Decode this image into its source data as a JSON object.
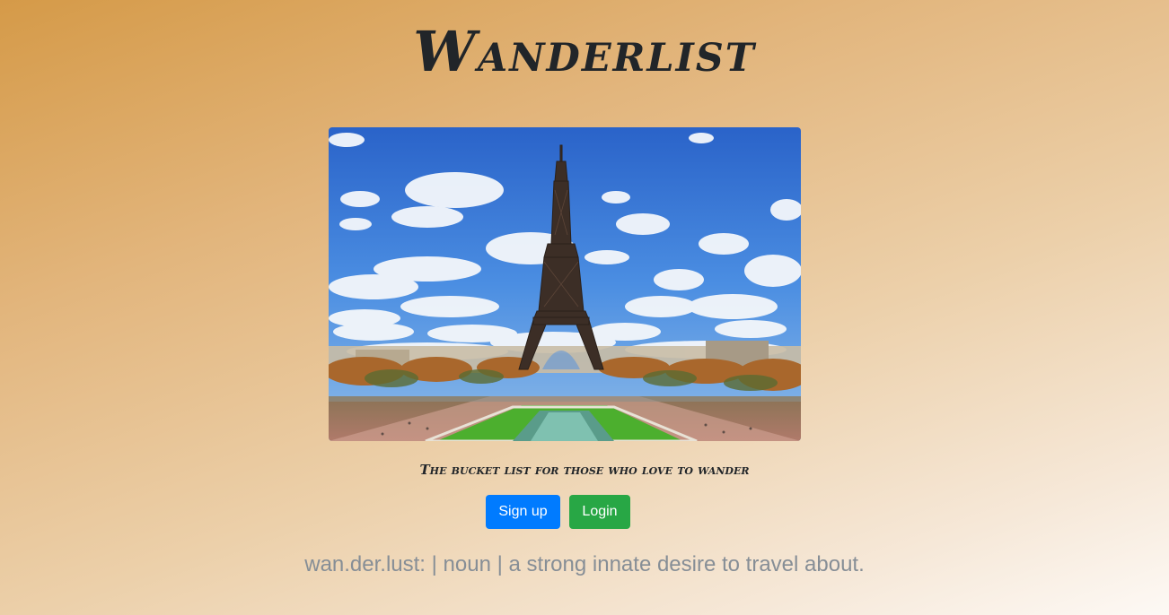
{
  "header": {
    "title": "Wanderlist"
  },
  "hero": {
    "alt": "Eiffel Tower, Paris"
  },
  "tagline": "The bucket list for those who love to wander",
  "actions": {
    "signup_label": "Sign up",
    "login_label": "Login"
  },
  "definition": "wan.der.lust: | noun | a strong innate desire to travel about.",
  "colors": {
    "signup": "#007bff",
    "login": "#28a745",
    "title": "#212529",
    "definition": "#868e96"
  }
}
